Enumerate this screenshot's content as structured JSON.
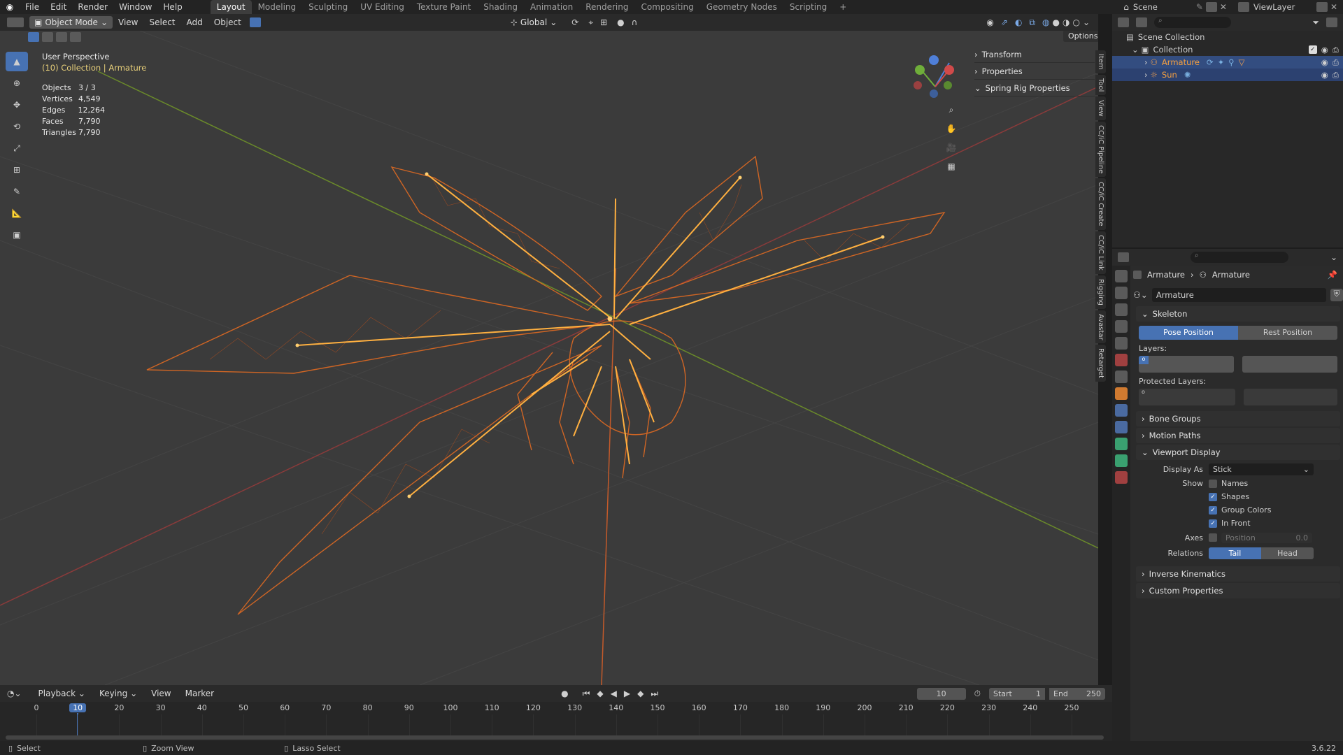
{
  "topbar": {
    "menus": [
      "File",
      "Edit",
      "Render",
      "Window",
      "Help"
    ],
    "workspaces": [
      "Layout",
      "Modeling",
      "Sculpting",
      "UV Editing",
      "Texture Paint",
      "Shading",
      "Animation",
      "Rendering",
      "Compositing",
      "Geometry Nodes",
      "Scripting"
    ],
    "active_workspace": "Layout",
    "scene": "Scene",
    "view_layer": "ViewLayer"
  },
  "viewport_header": {
    "mode": "Object Mode",
    "menus": [
      "View",
      "Select",
      "Add",
      "Object"
    ],
    "transform_orientation": "Global",
    "options_label": "Options"
  },
  "overlay": {
    "view_name": "User Perspective",
    "context": "(10) Collection | Armature",
    "stats": [
      {
        "label": "Objects",
        "value": "3 / 3"
      },
      {
        "label": "Vertices",
        "value": "4,549"
      },
      {
        "label": "Edges",
        "value": "12,264"
      },
      {
        "label": "Faces",
        "value": "7,790"
      },
      {
        "label": "Triangles",
        "value": "7,790"
      }
    ]
  },
  "npanel": {
    "sections": [
      "Transform",
      "Properties",
      "Spring Rig Properties"
    ]
  },
  "side_tabs": [
    "Item",
    "Tool",
    "View",
    "CC/iC Pipeline",
    "CC/iC Create",
    "CC/iC Link",
    "Rigging",
    "Avastar",
    "Retarget"
  ],
  "outliner": {
    "root": "Scene Collection",
    "collection": "Collection",
    "items": [
      "Armature",
      "Sun"
    ]
  },
  "properties": {
    "breadcrumb": [
      "Armature",
      "Armature"
    ],
    "datablock": "Armature",
    "skeleton": {
      "title": "Skeleton",
      "pose_position": "Pose Position",
      "rest_position": "Rest Position",
      "layers_label": "Layers:",
      "protected_layers_label": "Protected Layers:"
    },
    "collapsed_panels_top": [
      "Bone Groups",
      "Motion Paths"
    ],
    "viewport_display": {
      "title": "Viewport Display",
      "display_as_label": "Display As",
      "display_as_value": "Stick",
      "show_label": "Show",
      "names": "Names",
      "shapes": "Shapes",
      "group_colors": "Group Colors",
      "in_front": "In Front",
      "axes_label": "Axes",
      "axes_position": "Position",
      "axes_value": "0.0",
      "relations_label": "Relations",
      "tail": "Tail",
      "head": "Head"
    },
    "collapsed_panels_bottom": [
      "Inverse Kinematics",
      "Custom Properties"
    ]
  },
  "timeline": {
    "menus": [
      "Playback",
      "Keying",
      "View",
      "Marker"
    ],
    "current_frame": "10",
    "start_label": "Start",
    "start": "1",
    "end_label": "End",
    "end": "250",
    "ticks": [
      "0",
      "10",
      "20",
      "30",
      "40",
      "50",
      "60",
      "70",
      "80",
      "90",
      "100",
      "110",
      "120",
      "130",
      "140",
      "150",
      "160",
      "170",
      "180",
      "190",
      "200",
      "210",
      "220",
      "230",
      "240",
      "250"
    ]
  },
  "statusbar": {
    "select": "Select",
    "zoom": "Zoom View",
    "lasso": "Lasso Select",
    "version": "3.6.22"
  },
  "colors": {
    "accent": "#4772b3",
    "wire": "#e06a22",
    "bone": "#ffb040"
  }
}
